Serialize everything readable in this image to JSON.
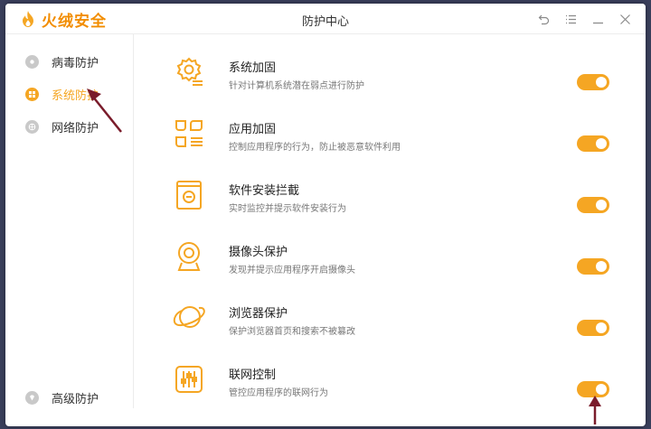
{
  "app": {
    "name": "火绒安全",
    "window_title": "防护中心",
    "brand_color": "#f5a623"
  },
  "window_controls": [
    {
      "icon": "back-icon"
    },
    {
      "icon": "menu-icon"
    },
    {
      "icon": "minimize-icon"
    },
    {
      "icon": "close-icon"
    }
  ],
  "sidebar": {
    "items": [
      {
        "label": "病毒防护",
        "icon": "virus-shield-icon",
        "active": false
      },
      {
        "label": "系统防护",
        "icon": "windows-icon",
        "active": true
      },
      {
        "label": "网络防护",
        "icon": "globe-icon",
        "active": false
      }
    ],
    "bottom_item": {
      "label": "高级防护",
      "icon": "diamond-icon"
    }
  },
  "protections": [
    {
      "title": "系统加固",
      "desc": "针对计算机系统潜在弱点进行防护",
      "icon": "gear-shield-icon",
      "enabled": true
    },
    {
      "title": "应用加固",
      "desc": "控制应用程序的行为，防止被恶意软件利用",
      "icon": "app-grid-icon",
      "enabled": true
    },
    {
      "title": "软件安装拦截",
      "desc": "实时监控并提示软件安装行为",
      "icon": "install-box-icon",
      "enabled": true
    },
    {
      "title": "摄像头保护",
      "desc": "发现并提示应用程序开启摄像头",
      "icon": "webcam-icon",
      "enabled": true
    },
    {
      "title": "浏览器保护",
      "desc": "保护浏览器首页和搜索不被篡改",
      "icon": "planet-icon",
      "enabled": true
    },
    {
      "title": "联网控制",
      "desc": "管控应用程序的联网行为",
      "icon": "sliders-icon",
      "enabled": true
    }
  ]
}
